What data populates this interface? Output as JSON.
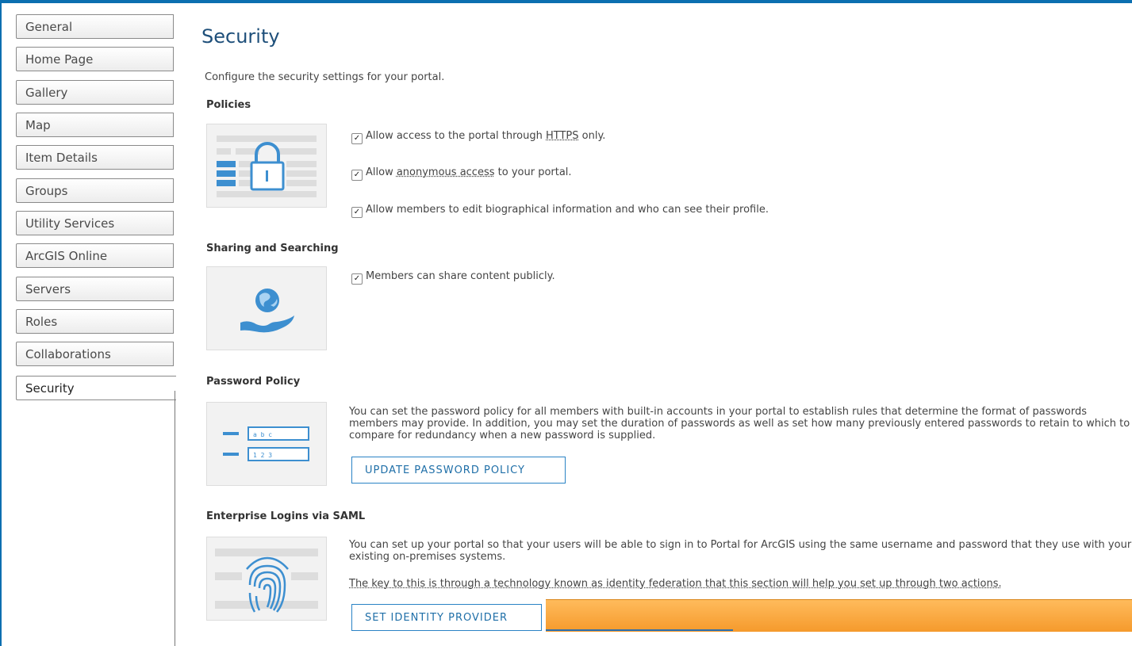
{
  "sidebar": {
    "items": [
      {
        "label": "General"
      },
      {
        "label": "Home Page"
      },
      {
        "label": "Gallery"
      },
      {
        "label": "Map"
      },
      {
        "label": "Item Details"
      },
      {
        "label": "Groups"
      },
      {
        "label": "Utility Services"
      },
      {
        "label": "ArcGIS Online"
      },
      {
        "label": "Servers"
      },
      {
        "label": "Roles"
      },
      {
        "label": "Collaborations"
      },
      {
        "label": "Security"
      }
    ],
    "active": "Security"
  },
  "main": {
    "title": "Security",
    "intro": "Configure the security settings for your portal.",
    "policies": {
      "heading": "Policies",
      "https": {
        "pre": "Allow access to the portal through ",
        "link": "HTTPS",
        "post": " only.",
        "checked": true
      },
      "anonymous": {
        "pre": "Allow ",
        "link": "anonymous access",
        "post": " to your portal.",
        "checked": true
      },
      "bio": {
        "label": "Allow members to edit biographical information and who can see their profile.",
        "checked": true
      }
    },
    "sharing": {
      "heading": "Sharing and Searching",
      "share_public": {
        "label": "Members can share content publicly.",
        "checked": true
      }
    },
    "password": {
      "heading": "Password Policy",
      "description": "You can set the password policy for all members with built-in accounts in your portal to establish rules that determine the format of passwords members may provide. In addition, you may set the duration of passwords as well as set how many previously entered passwords to retain to which to compare for redundancy when a new password is supplied.",
      "button": "UPDATE PASSWORD POLICY",
      "field1": "a b c",
      "field2": "1 2 3"
    },
    "saml": {
      "heading": "Enterprise Logins via SAML",
      "description1": "You can set up your portal so that your users will be able to sign in to Portal for ArcGIS using the same username and password that they use with your existing on-premises systems.",
      "description2": "The key to this is through a technology known as identity federation that this section will help you set up through two actions.",
      "button": "SET IDENTITY PROVIDER"
    }
  },
  "colors": {
    "accent": "#1f6fa8",
    "title": "#1e4f7a",
    "frame": "#0b6fb0",
    "highlight": "#f59a2c",
    "icon": "#3d8fd0"
  },
  "icons": {
    "checkbox": "checkmark-icon"
  }
}
